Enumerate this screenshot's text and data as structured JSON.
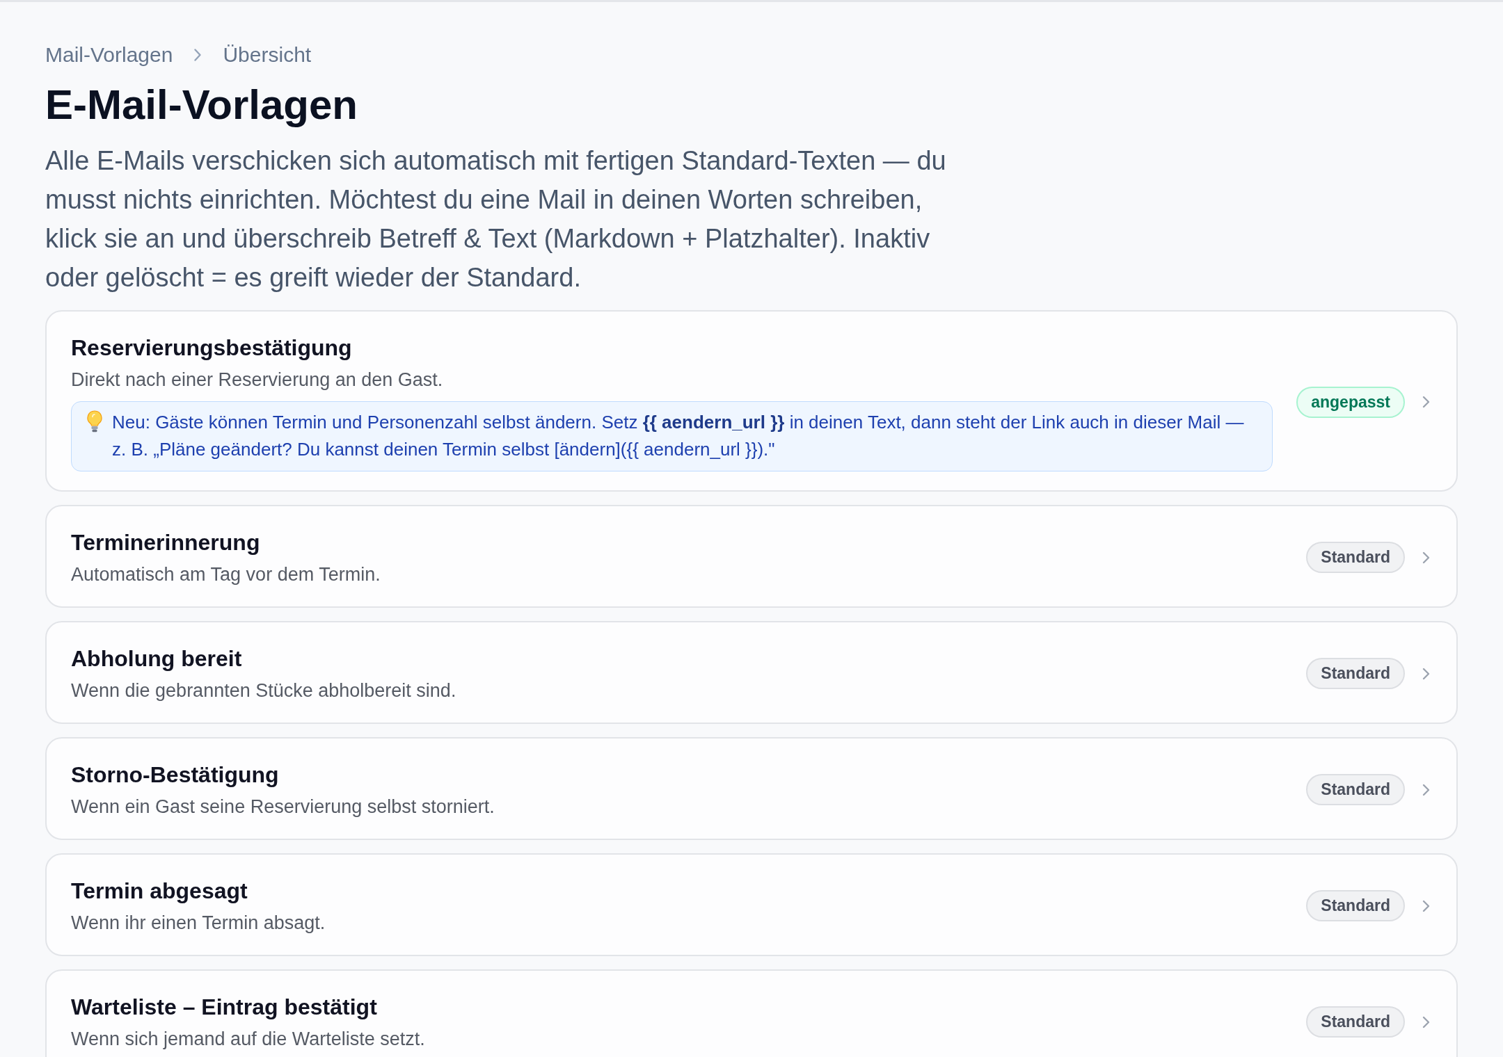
{
  "breadcrumb": [
    "Mail-Vorlagen",
    "Übersicht"
  ],
  "page_title": "E-Mail-Vorlagen",
  "intro": "Alle E-Mails verschicken sich automatisch mit fertigen Standard-Texten — du musst nichts einrichten. Möchtest du eine Mail in deinen Worten schreiben, klick sie an und überschreib Betreff & Text (Markdown + Platzhalter). Inaktiv oder gelöscht = es greift wieder der Standard.",
  "templates": [
    {
      "title": "Reservierungsbestätigung",
      "description": "Direkt nach einer Reservierung an den Gast.",
      "note": "Neu: Gäste können Termin und Personenzahl selbst ändern. Setz **{{ aendern_url }}** in deinen Text, dann steht der Link auch in dieser Mail — z. B. „Pläne geändert? Du kannst deinen Termin selbst [ändern]({{ aendern_url }}).\"",
      "badge": "angepasst",
      "customized": true
    },
    {
      "title": "Terminerinnerung",
      "description": "Automatisch am Tag vor dem Termin.",
      "badge": "Standard",
      "customized": false
    },
    {
      "title": "Abholung bereit",
      "description": "Wenn die gebrannten Stücke abholbereit sind.",
      "badge": "Standard",
      "customized": false
    },
    {
      "title": "Storno-Bestätigung",
      "description": "Wenn ein Gast seine Reservierung selbst storniert.",
      "badge": "Standard",
      "customized": false
    },
    {
      "title": "Termin abgesagt",
      "description": "Wenn ihr einen Termin absagt.",
      "badge": "Standard",
      "customized": false
    },
    {
      "title": "Warteliste – Eintrag bestätigt",
      "description": "Wenn sich jemand auf die Warteliste setzt.",
      "badge": "Standard",
      "customized": false
    }
  ]
}
